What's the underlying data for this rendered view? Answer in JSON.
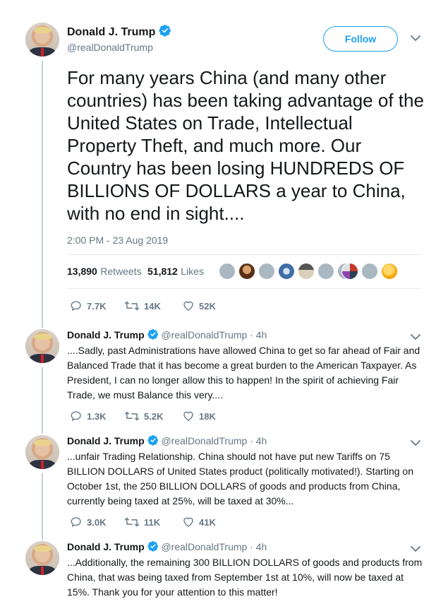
{
  "main_tweet": {
    "author_name": "Donald J. Trump",
    "author_handle": "@realDonaldTrump",
    "follow_label": "Follow",
    "text": "For many years China (and many other countries) has been taking advantage of the United States on Trade, Intellectual Property Theft, and much more. Our Country has been losing HUNDREDS OF BILLIONS OF DOLLARS a year to China, with no end in sight....",
    "timestamp": "2:00 PM - 23 Aug 2019",
    "retweets_count": "13,890",
    "retweets_label": "Retweets",
    "likes_count": "51,812",
    "likes_label": "Likes",
    "reply_count": "7.7K",
    "retweet_count_short": "14K",
    "like_count_short": "52K"
  },
  "replies": [
    {
      "author_name": "Donald J. Trump",
      "author_handle": "@realDonaldTrump",
      "time": "· 4h",
      "text": "....Sadly, past Administrations have allowed China to get so far ahead of Fair and Balanced Trade that it has become a great burden to the American Taxpayer. As President, I can no longer allow this to happen! In the spirit of achieving Fair Trade, we must Balance this very....",
      "reply_count": "1.3K",
      "retweet_count": "5.2K",
      "like_count": "18K"
    },
    {
      "author_name": "Donald J. Trump",
      "author_handle": "@realDonaldTrump",
      "time": "· 4h",
      "text": "...unfair Trading Relationship. China should not have put new Tariffs on 75 BILLION DOLLARS of United States product (politically motivated!). Starting on October 1st, the 250 BILLION DOLLARS of goods and products from China, currently being taxed at 25%, will be taxed at 30%...",
      "reply_count": "3.0K",
      "retweet_count": "11K",
      "like_count": "41K"
    },
    {
      "author_name": "Donald J. Trump",
      "author_handle": "@realDonaldTrump",
      "time": "· 4h",
      "text": "...Additionally, the remaining 300 BILLION DOLLARS of goods and products from China, that was being taxed from September 1st at 10%, will now be taxed at 15%. Thank you for your attention to this matter!"
    }
  ],
  "colors": {
    "accent": "#1da1f2",
    "text": "#14171a",
    "muted": "#657786",
    "divider": "#e6ecf0"
  },
  "icons": [
    "verified-icon",
    "caret-down-icon",
    "reply-icon",
    "retweet-icon",
    "like-icon"
  ]
}
